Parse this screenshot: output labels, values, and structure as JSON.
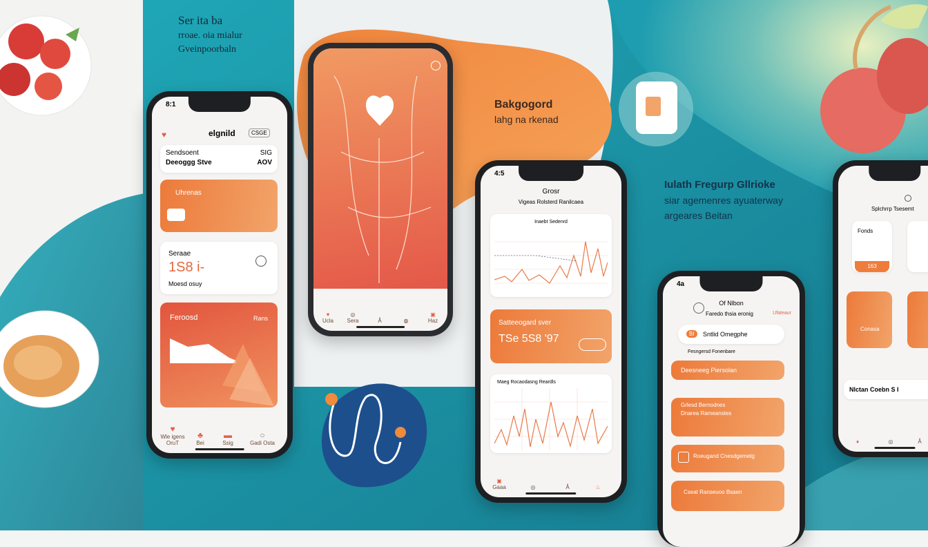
{
  "colors": {
    "teal": "#1f9fb0",
    "orange": "#ee7d3c",
    "navy": "#1d4f8c"
  },
  "header": {
    "line1": "Ser ita ba",
    "line2": "rroae. oia mialur",
    "line3": "Gveinpoorbaln"
  },
  "middle_label": {
    "title": "Bakgogord",
    "subtitle": "lahg na rkenad"
  },
  "right_label": {
    "title": "Iulath Fregurp Gllrioke",
    "line2": "siar agemenres ayuaterway",
    "line3": "argeares Beitan"
  },
  "phone1": {
    "status_time": "8:1",
    "brand": "elgnild",
    "brand_tag": "CSGE",
    "card1_title": "Sendsoent",
    "card1_sub": "Deeoggg Stve",
    "card1_val1": "SIG",
    "card1_val2": "AOV",
    "card2_title": "Uhrenas",
    "card3_title": "Seraae",
    "card3_value": "1S8 i-",
    "card3_sub": "Moesd osuy",
    "card4_title": "Feroosd",
    "card4_tag": "Rans",
    "tabs": [
      "Wle igens OruT",
      "Bei",
      "Ssig",
      "Gadi Osta"
    ]
  },
  "phone2": {
    "tabs": [
      "Ucla",
      "Sera",
      "",
      "",
      "Haz"
    ]
  },
  "phone3": {
    "status_time": "4:5",
    "title": "Grosr",
    "subtitle": "Vigeas Rolsterd Ranilcaea",
    "chart1_title": "Inaebt Sedenrd",
    "card_title": "Satteeogard sver",
    "card_value": "TSe 5S8 '97",
    "chart2_title": "Maeg Rocaodasng Reardls",
    "tabs": [
      "Gaaa",
      "",
      "",
      "",
      ""
    ]
  },
  "phone4": {
    "status_time": "4a",
    "title": "Of Nlbon",
    "subtitle": "Faredo thsia eronig",
    "link": "Ufateaur",
    "pill": "Sntlid Omegphe",
    "pill_num": "BI",
    "sub_row": "Fesngersd Fonenbare",
    "card1": "Deesneeg Piersolan",
    "card2_title": "Grlesd Bernodnes",
    "card2_sub": "Dnarea Rameanstes",
    "card3": "Roeugand Cnesdgemetg",
    "card4": "Cseat Ranseuoo Bsaen"
  },
  "phone5": {
    "title": "Splchrrp Tsesemt",
    "card1": "Fonds",
    "card1_val": "163",
    "card2": "Conasa",
    "row": "Nlctan Coebn S I",
    "tabs": [
      "",
      "",
      ""
    ]
  }
}
